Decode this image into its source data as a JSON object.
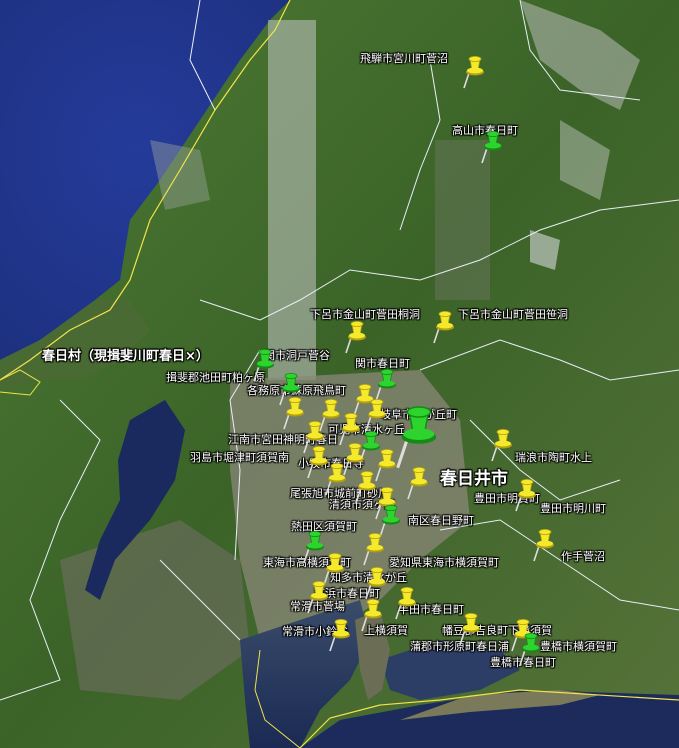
{
  "colors": {
    "sea": "#1d2f7a",
    "land_dark": "#3f6a2a",
    "land_light": "#6e8a4a",
    "urban": "#7d7a70",
    "snow": "#dde2e6",
    "border_white": "#e8eef5",
    "border_yellow": "#f2e34a",
    "pin_yellow": "#f4e92a",
    "pin_green": "#2ed42e"
  },
  "labels": [
    {
      "id": "hida-miyagawa",
      "text": "飛騨市宮川町菅沼"
    },
    {
      "id": "takayama",
      "text": "高山市春日町"
    },
    {
      "id": "gero-otoda",
      "text": "下呂市金山町菅田桐洞"
    },
    {
      "id": "gero-sasaho",
      "text": "下呂市金山町菅田笹洞"
    },
    {
      "id": "kasuga-village",
      "text": "春日村（現揖斐川町春日×）"
    },
    {
      "id": "seki-dodo",
      "text": "関市洞戸菅谷"
    },
    {
      "id": "ibi-ikeda",
      "text": "揖斐郡池田町粕ヶ原"
    },
    {
      "id": "kakamigahara",
      "text": "各務原市蘇原飛鳥町"
    },
    {
      "id": "seki-kasuga",
      "text": "関市春日町"
    },
    {
      "id": "gifu-shizuka",
      "text": "岐阜市静が丘町"
    },
    {
      "id": "kani-shimizu",
      "text": "可児市清水ヶ丘"
    },
    {
      "id": "konan-kasuga",
      "text": "江南市宮田神明町春日"
    },
    {
      "id": "hashima",
      "text": "羽島市堀津町須賀南"
    },
    {
      "id": "komaki",
      "text": "小牧市春日寺"
    },
    {
      "id": "mizunami",
      "text": "瑞浪市陶町水上"
    },
    {
      "id": "kasugai",
      "text": "春日井市"
    },
    {
      "id": "owari-asahi",
      "text": "尾張旭市城前町砂川"
    },
    {
      "id": "toyota-meiga",
      "text": "豊田市明賀町"
    },
    {
      "id": "kiyosu",
      "text": "清須市須ヶ口"
    },
    {
      "id": "toyota-myokawa",
      "text": "豊田市明川町"
    },
    {
      "id": "minami-hino",
      "text": "南区春日野町"
    },
    {
      "id": "atsuta",
      "text": "熱田区須賀町"
    },
    {
      "id": "tsukude",
      "text": "作手菅沼"
    },
    {
      "id": "tokai-takayokosuka",
      "text": "東海市高横須賀町"
    },
    {
      "id": "tokai-yokosuka",
      "text": "愛知県東海市横須賀町"
    },
    {
      "id": "chita",
      "text": "知多市清水が丘"
    },
    {
      "id": "takahama",
      "text": "高浜市春日町"
    },
    {
      "id": "tokoname-suga",
      "text": "常滑市菅場"
    },
    {
      "id": "handa",
      "text": "半田市春日町"
    },
    {
      "id": "kira",
      "text": "幡豆郡吉良町下横須賀"
    },
    {
      "id": "tokoname-suzu",
      "text": "常滑市小鈴谷"
    },
    {
      "id": "kamiyokosuka",
      "text": "上横須賀"
    },
    {
      "id": "gamagori",
      "text": "蒲郡市形原町春日浦"
    },
    {
      "id": "toyohashi-yokosuka",
      "text": "豊橋市横須賀町"
    },
    {
      "id": "toyohashi-kasuga",
      "text": "豊橋市春日町"
    }
  ],
  "pins": [
    {
      "id": "p-hida",
      "color": "yellow"
    },
    {
      "id": "p-takayama",
      "color": "green"
    },
    {
      "id": "p-gero1",
      "color": "yellow"
    },
    {
      "id": "p-gero2",
      "color": "yellow"
    },
    {
      "id": "p-dodo",
      "color": "green"
    },
    {
      "id": "p-ikeda",
      "color": "green"
    },
    {
      "id": "p-seki",
      "color": "green"
    },
    {
      "id": "p-kakami",
      "color": "yellow"
    },
    {
      "id": "p-gifu",
      "color": "yellow"
    },
    {
      "id": "p-kani",
      "color": "yellow"
    },
    {
      "id": "p-cluster1",
      "color": "yellow"
    },
    {
      "id": "p-cluster2",
      "color": "yellow"
    },
    {
      "id": "p-cluster3",
      "color": "yellow"
    },
    {
      "id": "p-cluster4",
      "color": "green"
    },
    {
      "id": "p-cluster5",
      "color": "yellow"
    },
    {
      "id": "p-cluster6",
      "color": "yellow"
    },
    {
      "id": "p-hashima",
      "color": "yellow"
    },
    {
      "id": "p-komaki",
      "color": "yellow"
    },
    {
      "id": "p-kasugai",
      "color": "green",
      "size": "big"
    },
    {
      "id": "p-mizunami",
      "color": "yellow"
    },
    {
      "id": "p-seto",
      "color": "yellow"
    },
    {
      "id": "p-asahi",
      "color": "yellow"
    },
    {
      "id": "p-kiyosu",
      "color": "yellow"
    },
    {
      "id": "p-minami",
      "color": "green"
    },
    {
      "id": "p-meiga",
      "color": "yellow"
    },
    {
      "id": "p-atsuta",
      "color": "green"
    },
    {
      "id": "p-tsukude",
      "color": "yellow"
    },
    {
      "id": "p-tokai1",
      "color": "yellow"
    },
    {
      "id": "p-tokai2",
      "color": "yellow"
    },
    {
      "id": "p-chita",
      "color": "yellow"
    },
    {
      "id": "p-takahama",
      "color": "yellow"
    },
    {
      "id": "p-handa",
      "color": "yellow"
    },
    {
      "id": "p-tokoname1",
      "color": "yellow"
    },
    {
      "id": "p-tokoname2",
      "color": "yellow"
    },
    {
      "id": "p-kira",
      "color": "yellow"
    },
    {
      "id": "p-gamagori",
      "color": "yellow"
    },
    {
      "id": "p-toyohashi",
      "color": "green"
    }
  ]
}
